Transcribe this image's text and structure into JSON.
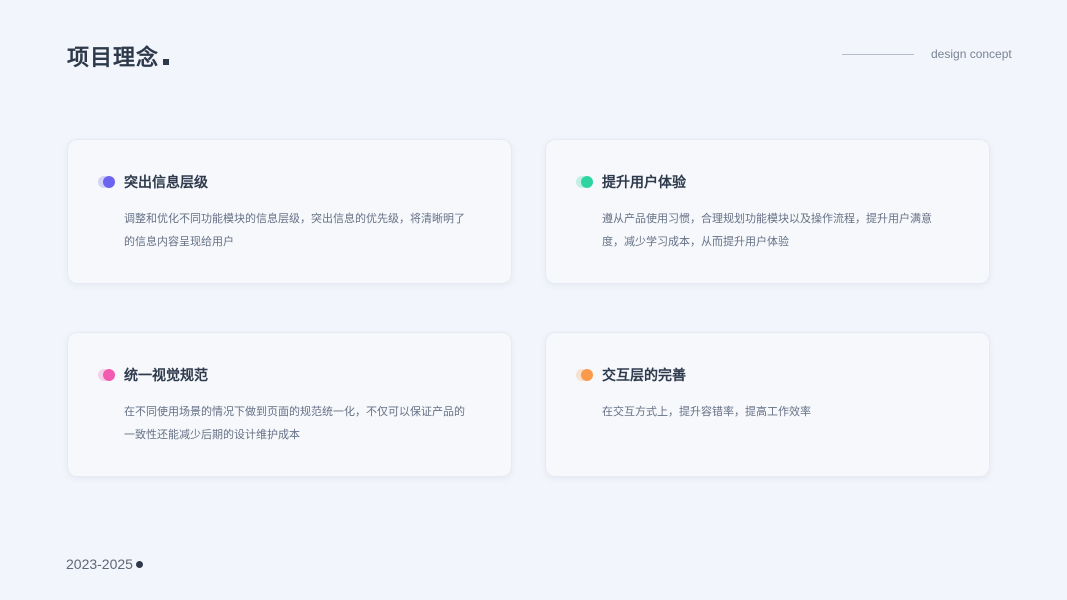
{
  "header": {
    "title": "项目理念",
    "subtitle": "design concept"
  },
  "cards": [
    {
      "title": "突出信息层级",
      "description": "调整和优化不同功能模块的信息层级，突出信息的优先级，将清晰明了的信息内容呈现给用户",
      "accent": "#6c63ee"
    },
    {
      "title": "提升用户体验",
      "description": "遵从产品使用习惯，合理规划功能模块以及操作流程，提升用户满意度，减少学习成本，从而提升用户体验",
      "accent": "#2dd4a0"
    },
    {
      "title": "统一视觉规范",
      "description": "在不同使用场景的情况下做到页面的规范统一化，不仅可以保证产品的一致性还能减少后期的设计维护成本",
      "accent": "#f25bb0"
    },
    {
      "title": "交互层的完善",
      "description": "在交互方式上，提升容错率，提高工作效率",
      "accent": "#fb9a4b"
    }
  ],
  "footer": {
    "year_range": "2023-2025"
  }
}
